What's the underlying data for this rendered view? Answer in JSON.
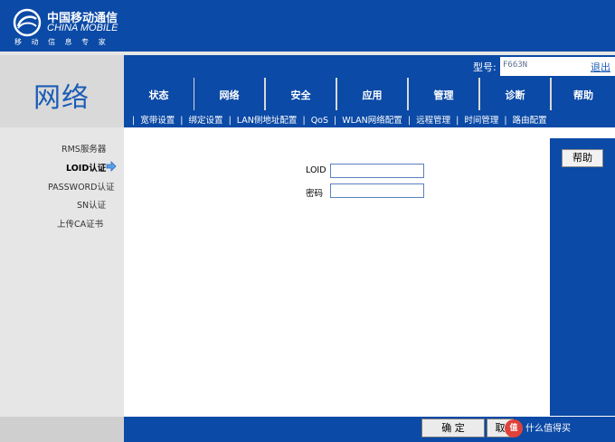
{
  "brand": {
    "name_cn": "中国移动通信",
    "name_en": "CHINA MOBILE",
    "tagline": "移 动 信 息 专 家"
  },
  "section_title": "网络",
  "device": {
    "model_label": "型号:",
    "model_value": "F663N",
    "logout_label": "退出"
  },
  "tabs": [
    {
      "label": "状态"
    },
    {
      "label": "网络"
    },
    {
      "label": "安全"
    },
    {
      "label": "应用"
    },
    {
      "label": "管理"
    },
    {
      "label": "诊断"
    },
    {
      "label": "帮助"
    }
  ],
  "active_tab": "网络",
  "subnav": [
    {
      "label": "宽带设置"
    },
    {
      "label": "绑定设置"
    },
    {
      "label": "LAN侧地址配置"
    },
    {
      "label": "QoS"
    },
    {
      "label": "WLAN网络配置"
    },
    {
      "label": "远程管理"
    },
    {
      "label": "时间管理"
    },
    {
      "label": "路由配置"
    }
  ],
  "subnav_separator": "|",
  "active_subnav": "远程管理",
  "side_menu": [
    {
      "label": "RMS服务器"
    },
    {
      "label": "LOID认证"
    },
    {
      "label": "PASSWORD认证"
    },
    {
      "label": "SN认证"
    },
    {
      "label": "上传CA证书"
    }
  ],
  "active_side_item": "LOID认证",
  "form": {
    "loid_label": "LOID",
    "loid_value": "",
    "password_label": "密码",
    "password_value": ""
  },
  "right_panel": {
    "help_label": "帮助"
  },
  "actions": {
    "confirm_label": "确 定",
    "cancel_label": "取"
  },
  "watermark": {
    "badge": "值",
    "text": "什么值得买"
  },
  "colors": {
    "primary_blue": "#0b4aa6",
    "panel_grey": "#d9d9d9",
    "title_blue": "#1b5cb5"
  }
}
